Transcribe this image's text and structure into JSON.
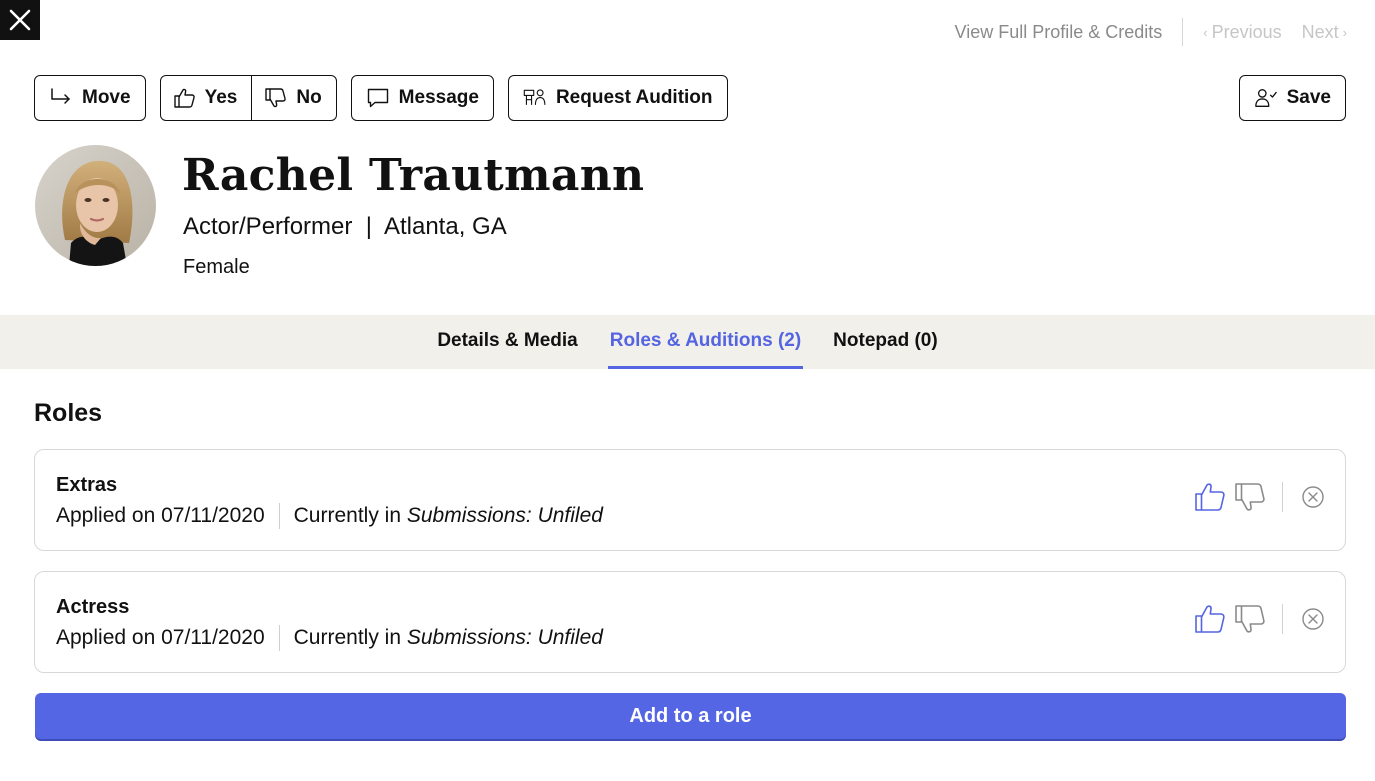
{
  "nav": {
    "close_icon": "close-icon",
    "full_profile": "View Full Profile & Credits",
    "previous": "Previous",
    "next": "Next"
  },
  "toolbar": {
    "move": "Move",
    "yes": "Yes",
    "no": "No",
    "message": "Message",
    "request_audition": "Request Audition",
    "save": "Save"
  },
  "profile": {
    "name": "Rachel Trautmann",
    "role": "Actor/Performer",
    "separator": "|",
    "location": "Atlanta, GA",
    "gender": "Female"
  },
  "tabs": [
    {
      "label": "Details & Media",
      "active": false
    },
    {
      "label": "Roles & Auditions (2)",
      "active": true
    },
    {
      "label": "Notepad (0)",
      "active": false
    }
  ],
  "roles_section": {
    "title": "Roles",
    "items": [
      {
        "title": "Extras",
        "applied": "Applied on 07/11/2020",
        "currently_prefix": "Currently in",
        "currently_value": "Submissions: Unfiled"
      },
      {
        "title": "Actress",
        "applied": "Applied on 07/11/2020",
        "currently_prefix": "Currently in",
        "currently_value": "Submissions: Unfiled"
      }
    ]
  },
  "add_role": "Add to a role",
  "colors": {
    "accent": "#5565e2",
    "button_primary": "#5566e4",
    "tab_bar": "#f1f0eb",
    "thumb_up_active": "#5565e2",
    "thumb_down": "#8a8a8a"
  }
}
